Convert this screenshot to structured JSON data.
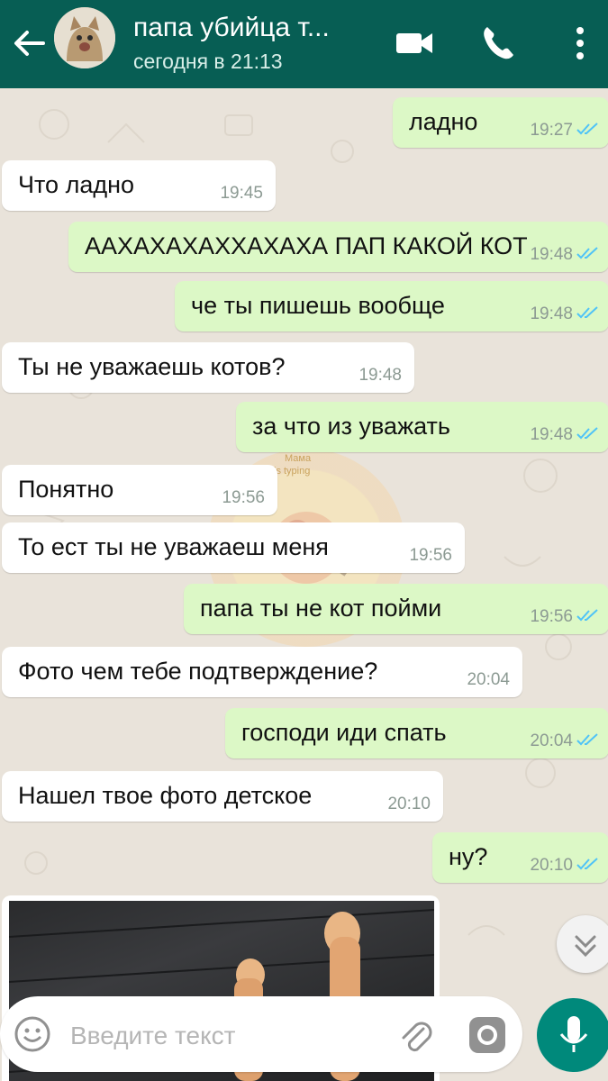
{
  "header": {
    "title": "папа убийца т...",
    "subtitle": "сегодня в 21:13"
  },
  "messages": [
    {
      "dir": "out",
      "text": "ладно",
      "time": "19:27"
    },
    {
      "dir": "in",
      "text": "Что ладно",
      "time": "19:45"
    },
    {
      "dir": "out",
      "text": "ААХАХАХАХХАХАХА ПАП КАКОЙ КОТ",
      "time": "19:48"
    },
    {
      "dir": "out",
      "text": "че ты пишешь вообще",
      "time": "19:48"
    },
    {
      "dir": "in",
      "text": "Ты не уважаешь котов?",
      "time": "19:48"
    },
    {
      "dir": "out",
      "text": "за что из уважать",
      "time": "19:48"
    },
    {
      "dir": "in",
      "text": "Понятно",
      "time": "19:56"
    },
    {
      "dir": "in",
      "text": "То ест ты не уважаеш меня",
      "time": "19:56"
    },
    {
      "dir": "out",
      "text": "папа ты не кот пойми",
      "time": "19:56"
    },
    {
      "dir": "in",
      "text": "Фото чем тебе подтверждение?",
      "time": "20:04"
    },
    {
      "dir": "out",
      "text": "господи иди спать",
      "time": "20:04"
    },
    {
      "dir": "in",
      "text": "Нашел твое фото детское",
      "time": "20:10"
    },
    {
      "dir": "out",
      "text": "ну?",
      "time": "20:10"
    }
  ],
  "watermark": {
    "text_top": "Мама",
    "text_bottom": "is typing"
  },
  "composer": {
    "placeholder": "Введите текст"
  },
  "colors": {
    "header": "#075e54",
    "outgoing": "#dcf8c6",
    "incoming": "#ffffff",
    "ticks": "#4fc3f7",
    "mic": "#00897b"
  },
  "icons": [
    "back-arrow-icon",
    "video-call-icon",
    "phone-icon",
    "more-vertical-icon",
    "double-check-icon",
    "emoji-icon",
    "attach-icon",
    "camera-icon",
    "mic-icon",
    "chevron-double-down-icon"
  ]
}
